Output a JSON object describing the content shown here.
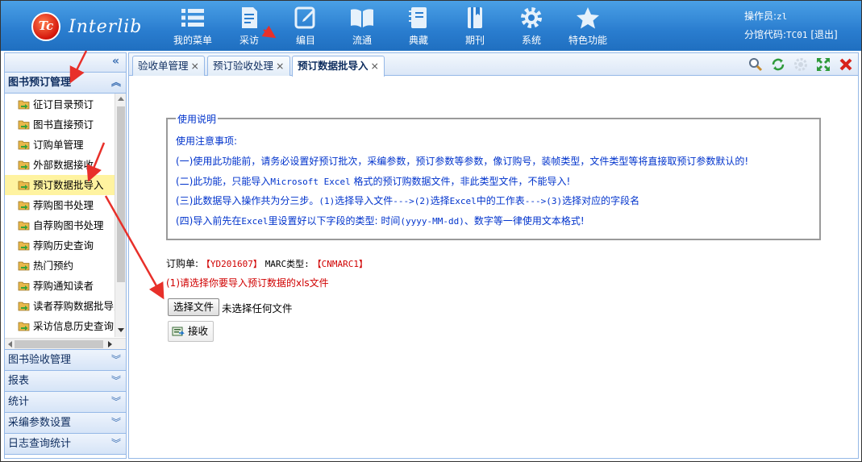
{
  "app": {
    "name": "Interlib",
    "logo_letters": "Tc"
  },
  "nav": [
    {
      "label": "我的菜单",
      "icon": "list-icon"
    },
    {
      "label": "采访",
      "icon": "document-icon"
    },
    {
      "label": "编目",
      "icon": "edit-icon"
    },
    {
      "label": "流通",
      "icon": "book-icon"
    },
    {
      "label": "典藏",
      "icon": "notebook-icon"
    },
    {
      "label": "期刊",
      "icon": "journal-icon"
    },
    {
      "label": "系统",
      "icon": "gear-icon"
    },
    {
      "label": "特色功能",
      "icon": "star-icon"
    }
  ],
  "user": {
    "operator_label": "操作员:",
    "operator": "zl",
    "branch_label": "分馆代码:",
    "branch": "TC01",
    "logout": "[退出]"
  },
  "sidebar": {
    "collapse": "«",
    "active_panel": "图书预订管理",
    "items": [
      "征订目录预订",
      "图书直接预订",
      "订购单管理",
      "外部数据接收",
      "预订数据批导入",
      "荐购图书处理",
      "自荐购图书处理",
      "荐购历史查询",
      "热门预约",
      "荐购通知读者",
      "读者荐购数据批导入",
      "采访信息历史查询"
    ],
    "selected_index": 4,
    "panels": [
      "图书验收管理",
      "报表",
      "统计",
      "采编参数设置",
      "日志查询统计"
    ]
  },
  "tabs": [
    {
      "label": "验收单管理",
      "active": false
    },
    {
      "label": "预订验收处理",
      "active": false
    },
    {
      "label": "预订数据批导入",
      "active": true
    }
  ],
  "toolbar": [
    "search-icon",
    "refresh-icon",
    "settings-icon",
    "maximize-icon",
    "close-icon"
  ],
  "instructions": {
    "legend": "使用说明",
    "heading": "使用注意事项:",
    "l1": "(一)使用此功能前，请务必设置好预订批次，采编参数，预订参数等参数，像订购号，装帧类型，文件类型等将直接取预订参数默认的!",
    "l2a": "(二)此功能，只能导入",
    "l2b": "Microsoft Excel",
    "l2c": " 格式的预订购数据文件，非此类型文件，不能导入!",
    "l3a": "(三)此数据导入操作共为分三步。",
    "l3b": "(1)",
    "l3c": "选择导入文件",
    "l3d": "--->(2)",
    "l3e": "选择",
    "l3f": "Excel",
    "l3g": "中的工作表",
    "l3h": "--->(3)",
    "l3i": "选择对应的字段名",
    "l4a": "(四)导入前先在",
    "l4b": "Excel",
    "l4c": "里设置好以下字段的类型: 时间",
    "l4d": "(yyyy-MM-dd)",
    "l4e": "、数字等一律使用文本格式!"
  },
  "order": {
    "order_label": "订购单:",
    "order_value": "【YD201607】",
    "marc_label": "MARC类型:",
    "marc_value": "【CNMARC1】"
  },
  "step1": "(1)请选择你要导入预订数据的xls文件",
  "file": {
    "button": "选择文件",
    "status": "未选择任何文件"
  },
  "receive": "接收",
  "colors": {
    "header": "#2a7dcf",
    "border": "#95b8e7",
    "instruction_text": "#0033cc",
    "red": "#d00000",
    "selected_item": "#fff3a0",
    "annotation": "#e8302a"
  }
}
